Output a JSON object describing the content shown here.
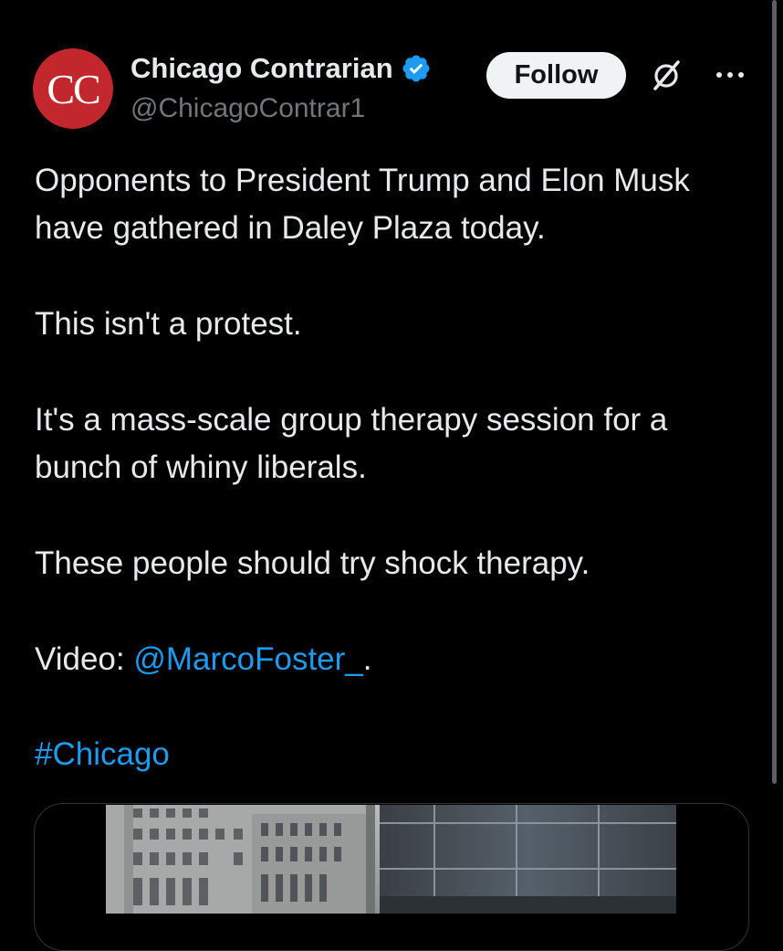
{
  "author": {
    "avatar_text": "CC",
    "display_name": "Chicago Contrarian",
    "handle": "@ChicagoContrar1",
    "verified": true
  },
  "actions": {
    "follow_label": "Follow",
    "grok_icon": "grok-icon",
    "more_icon": "more-horizontal-icon"
  },
  "post": {
    "line1": "Opponents to President Trump and Elon Musk have gathered in Daley Plaza today.",
    "line2": "This isn't a protest.",
    "line3": "It's a mass-scale group therapy session for a bunch of whiny liberals.",
    "line4": "These people should try shock therapy.",
    "video_prefix": "Video: ",
    "video_mention": "@MarcoFoster_",
    "video_suffix": ".",
    "hashtag": "#Chicago"
  },
  "colors": {
    "background": "#000000",
    "text": "#e7e9ea",
    "secondary": "#71767b",
    "link": "#1d9bf0",
    "avatar": "#c2272d",
    "verified": "#1d9bf0"
  }
}
